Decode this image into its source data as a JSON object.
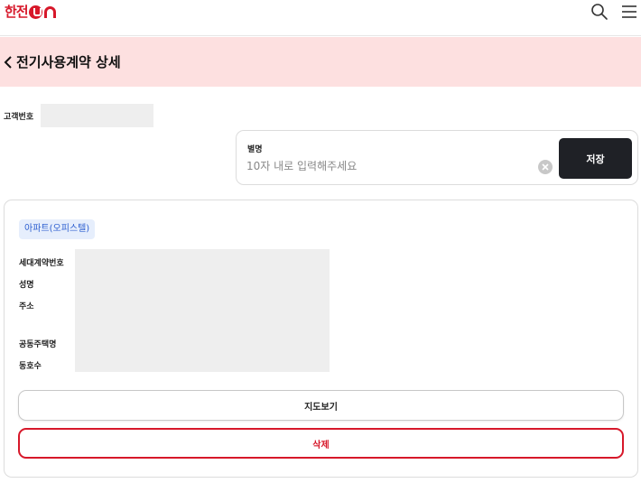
{
  "header": {
    "logo_text": "한전",
    "logo_on_text": "ON",
    "search_icon": "search-icon",
    "menu_icon": "hamburger-menu-icon",
    "brand_color": "#d7182a"
  },
  "titlebar": {
    "title": "전기사용계약 상세",
    "back_icon": "chevron-left-icon",
    "background": "#fde0e0"
  },
  "customer": {
    "label": "고객번호",
    "value": ""
  },
  "alias": {
    "label": "별명",
    "value": "",
    "placeholder": "10자 내로 입력해주세요",
    "clear_icon": "clear-circle-icon",
    "save_label": "저장"
  },
  "contract": {
    "type_badge": "아파트(오피스텔)",
    "fields": [
      {
        "label": "세대계약번호",
        "value": ""
      },
      {
        "label": "성명",
        "value": ""
      },
      {
        "label": "주소",
        "value": ""
      },
      {
        "label": "공동주택명",
        "value": ""
      },
      {
        "label": "동호수",
        "value": ""
      }
    ],
    "map_button_label": "지도보기",
    "delete_button_label": "삭제"
  }
}
